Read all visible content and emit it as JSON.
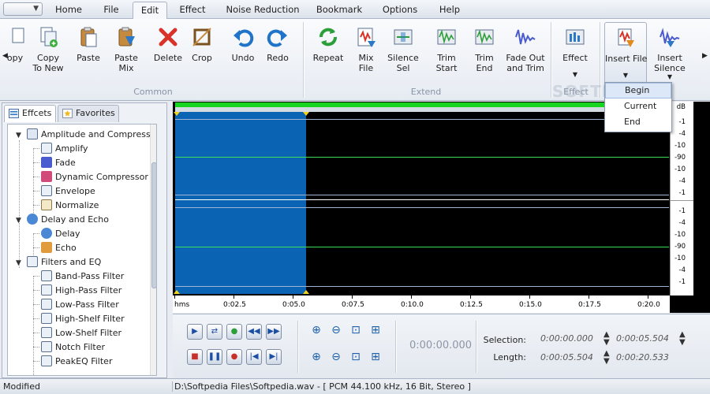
{
  "menu": {
    "tabs": [
      "Home",
      "File",
      "Edit",
      "Effect",
      "Noise Reduction",
      "Bookmark",
      "Options",
      "Help"
    ],
    "active_tab": "Edit"
  },
  "ribbon": {
    "buttons": {
      "copy_to_new": "Copy\nTo New",
      "copy_partial": "opy",
      "paste": "Paste",
      "paste_mix": "Paste\nMix",
      "delete": "Delete",
      "crop": "Crop",
      "undo": "Undo",
      "redo": "Redo",
      "repeat": "Repeat",
      "mix_file": "Mix\nFile",
      "silence_sel": "Silence\nSel",
      "trim_start": "Trim\nStart",
      "trim_end": "Trim\nEnd",
      "fade_out_trim": "Fade Out\nand Trim",
      "effect": "Effect",
      "insert_file": "Insert File",
      "insert_silence": "Insert\nSilence"
    },
    "groups": {
      "common": "Common",
      "extend": "Extend",
      "effect": "Effect"
    }
  },
  "insert_dropdown": {
    "items": [
      "Begin",
      "Current",
      "End"
    ],
    "highlighted": "Begin"
  },
  "watermark": "SOFTPEDIA",
  "left_panel": {
    "tabs": [
      "Effcets",
      "Favorites"
    ],
    "active_tab": "Effcets",
    "tree": [
      {
        "label": "Amplitude and Compressi",
        "children": [
          "Amplify",
          "Fade",
          "Dynamic Compressor",
          "Envelope",
          "Normalize"
        ]
      },
      {
        "label": "Delay and Echo",
        "children": [
          "Delay",
          "Echo"
        ]
      },
      {
        "label": "Filters and EQ",
        "children": [
          "Band-Pass Filter",
          "High-Pass Filter",
          "Low-Pass Filter",
          "High-Shelf Filter",
          "Low-Shelf Filter",
          "Notch Filter",
          "PeakEQ Filter"
        ]
      }
    ]
  },
  "waveform": {
    "db_unit": "dB",
    "db_top": [
      "-1",
      "-4",
      "-10",
      "-90",
      "-10",
      "-4",
      "-1"
    ],
    "db_bottom": [
      "-1",
      "-4",
      "-10",
      "-90",
      "-10",
      "-4",
      "-1"
    ],
    "ruler_labels": [
      "hms",
      "0:02.5",
      "0:05.0",
      "0:07.5",
      "0:10.0",
      "0:12.5",
      "0:15.0",
      "0:17.5",
      "0:20.0"
    ]
  },
  "transport": {
    "position": "0:00:00.000",
    "selection_label": "Selection:",
    "length_label": "Length:",
    "selection_start": "0:00:00.000",
    "selection_end": "0:00:05.504",
    "length_start": "0:00:05.504",
    "length_total": "0:00:20.533"
  },
  "status": {
    "left": "Modified",
    "right": "D:\\Softpedia Files\\Softpedia.wav - [ PCM 44.100 kHz, 16 Bit, Stereo ]"
  }
}
